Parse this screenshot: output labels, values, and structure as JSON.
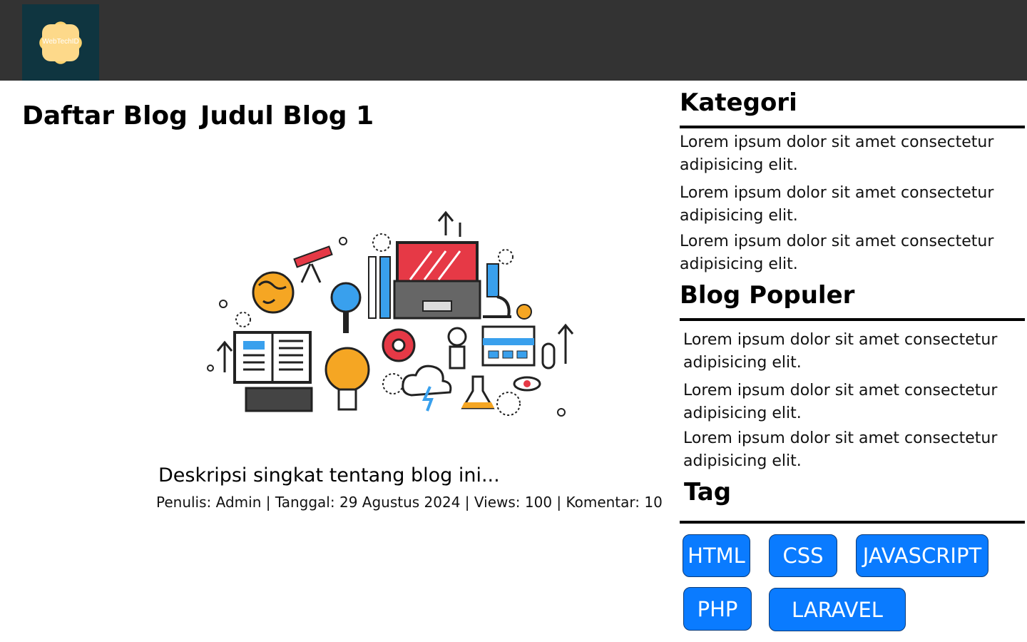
{
  "header": {
    "logo_text": "WebTechID",
    "bg_color": "#333333",
    "logo_bg": "#0f3540",
    "logo_color": "#fcd36e"
  },
  "main": {
    "blog_list_heading": "Daftar Blog",
    "blog_title": "Judul Blog 1",
    "description": "Deskripsi singkat tentang blog ini...",
    "meta": "Penulis: Admin | Tanggal: 29 Agustus 2024 | Views: 100 | Komentar: 10",
    "image_icon": "tech-illustration-icon"
  },
  "sidebar": {
    "categories": {
      "title": "Kategori",
      "items": [
        "Lorem ipsum dolor sit amet consectetur adipisicing elit.",
        "Lorem ipsum dolor sit amet consectetur adipisicing elit.",
        "Lorem ipsum dolor sit amet consectetur adipisicing elit."
      ]
    },
    "popular": {
      "title": "Blog Populer",
      "items": [
        "Lorem ipsum dolor sit amet consectetur adipisicing elit.",
        "Lorem ipsum dolor sit amet consectetur adipisicing elit.",
        "Lorem ipsum dolor sit amet consectetur adipisicing elit."
      ]
    },
    "tags": {
      "title": "Tag",
      "items": [
        "HTML",
        "CSS",
        "JAVASCRIPT",
        "PHP",
        "LARAVEL"
      ],
      "color": "#0a7bff"
    }
  }
}
